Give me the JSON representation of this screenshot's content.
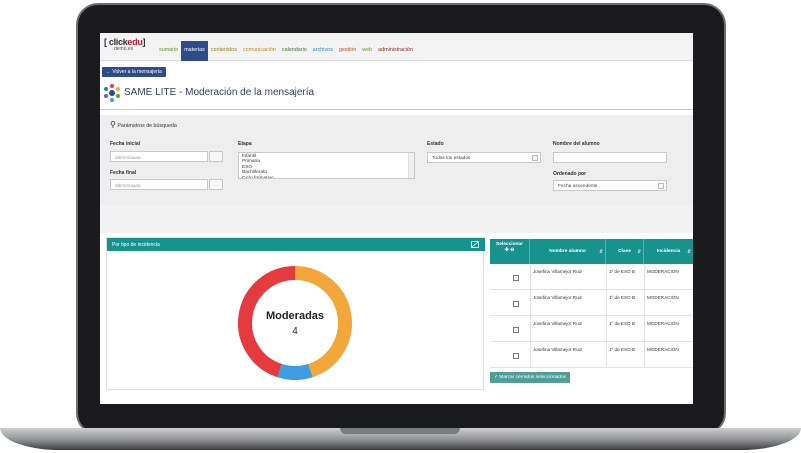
{
  "logo": {
    "text_prefix": "[ click",
    "text_accent": "edu",
    "text_suffix": "]",
    "sub": "demo.es"
  },
  "nav": {
    "items": [
      {
        "label": "sumario",
        "color": "#6a8e2a"
      },
      {
        "label": "materias",
        "color": "#ffffff"
      },
      {
        "label": "contenidos",
        "color": "#9a7b1d"
      },
      {
        "label": "comunicación",
        "color": "#c98a12"
      },
      {
        "label": "calendario",
        "color": "#3f7a3d"
      },
      {
        "label": "archivos",
        "color": "#2e8bc0"
      },
      {
        "label": "gestión",
        "color": "#b7502a"
      },
      {
        "label": "web",
        "color": "#5aa02c"
      },
      {
        "label": "administración",
        "color": "#8a2b2b"
      }
    ],
    "active_index": 1
  },
  "header": {
    "back_label": "Volver a la mensajería",
    "title": "SAME LITE - Moderación de la mensajería"
  },
  "filters": {
    "title": "Parámetros de búsqueda",
    "fecha_inicial_label": "Fecha inicial",
    "fecha_inicial_placeholder": "dd/mm/aaaa",
    "fecha_final_label": "Fecha final",
    "fecha_final_placeholder": "dd/mm/aaaa",
    "etapa_label": "Etapa",
    "etapa_options": [
      "Infantil",
      "Primaria",
      "ESO",
      "Bachillerato",
      "Ciclo formativo"
    ],
    "estado_label": "Estado",
    "estado_value": "Todos los estados",
    "nombre_label": "Nombre del alumno",
    "nombre_value": "",
    "ordenado_label": "Ordenado por",
    "ordenado_value": "Fecha ascendente"
  },
  "chart_panel": {
    "title": "Por tipo de incidencia",
    "center_label": "Moderadas",
    "center_value": "4"
  },
  "chart_data": {
    "type": "pie",
    "categories": [
      "Moderadas"
    ],
    "values": [
      4
    ],
    "segment_percents": [
      45,
      10,
      45
    ],
    "segment_colors": [
      "#f3a73a",
      "#3d9de0",
      "#e53a3e"
    ]
  },
  "table": {
    "headers": [
      "Seleccionar",
      "Nombre alumno",
      "Clase",
      "Incidencia"
    ],
    "rows": [
      {
        "nombre": "Josefina Villamejor Ruiz",
        "clase": "1º de ESO B",
        "incidencia": "MODERACIÓN"
      },
      {
        "nombre": "Josefina Villamejor Ruiz",
        "clase": "1º de ESO B",
        "incidencia": "MODERACIÓN"
      },
      {
        "nombre": "Josefina Villamejor Ruiz",
        "clase": "1º de ESO B",
        "incidencia": "MODERACIÓN"
      },
      {
        "nombre": "Josefina Villamejor Ruiz",
        "clase": "1º de ESO B",
        "incidencia": "MODERACIÓN"
      }
    ],
    "mark_button": "Marcar cerrados seleccionados"
  }
}
